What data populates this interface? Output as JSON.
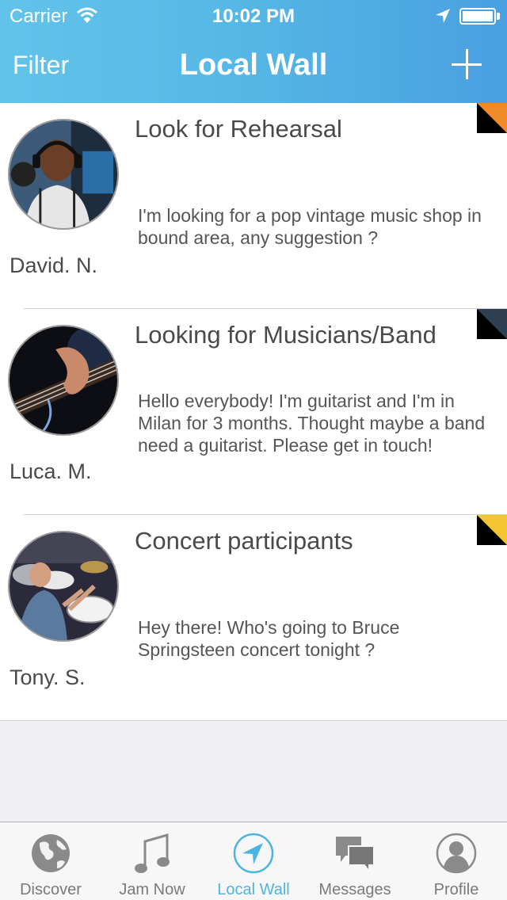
{
  "status": {
    "carrier": "Carrier",
    "time": "10:02 PM"
  },
  "nav": {
    "left_label": "Filter",
    "title": "Local Wall"
  },
  "posts": [
    {
      "title": "Look for Rehearsal",
      "author": "David. N.",
      "body": "I'm looking for a pop vintage music shop in bound area, any suggestion ?",
      "tag_color": "#f0892a"
    },
    {
      "title": "Looking for Musicians/Band",
      "author": "Luca. M.",
      "body": "Hello everybody! I'm guitarist and I'm in Milan for 3 months. Thought maybe a band need a guitarist. Please get in touch!",
      "tag_color": "#2f3f52"
    },
    {
      "title": "Concert participants",
      "author": "Tony. S.",
      "body": "Hey there! Who's going to Bruce Springsteen concert tonight ?",
      "tag_color": "#f4c431"
    }
  ],
  "tabs": [
    {
      "label": "Discover",
      "icon": "globe-icon"
    },
    {
      "label": "Jam Now",
      "icon": "music-note-icon"
    },
    {
      "label": "Local Wall",
      "icon": "location-arrow-icon",
      "active": true
    },
    {
      "label": "Messages",
      "icon": "chat-bubbles-icon"
    },
    {
      "label": "Profile",
      "icon": "user-icon"
    }
  ],
  "colors": {
    "accent": "#4ab5e3",
    "header_start": "#62c3ea",
    "header_end": "#4a9fe0"
  }
}
